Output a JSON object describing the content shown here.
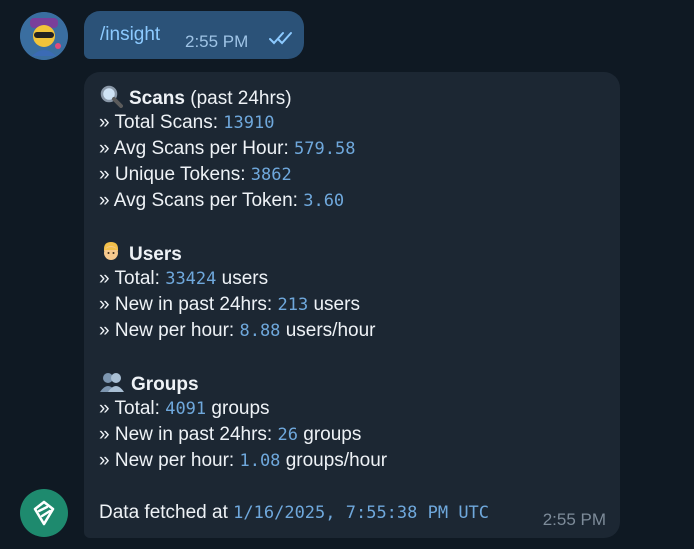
{
  "outgoing": {
    "command": "/insight",
    "time": "2:55 PM",
    "status_icon": "double-check-icon"
  },
  "incoming": {
    "time": "2:55 PM",
    "scans": {
      "icon": "magnifier-icon",
      "title": "Scans",
      "subtitle": "(past 24hrs)",
      "rows": [
        {
          "label": "» Total Scans: ",
          "value": "13910",
          "suffix": ""
        },
        {
          "label": "» Avg Scans per Hour: ",
          "value": "579.58",
          "suffix": ""
        },
        {
          "label": "» Unique Tokens: ",
          "value": "3862",
          "suffix": ""
        },
        {
          "label": "» Avg Scans per Token: ",
          "value": "3.60",
          "suffix": ""
        }
      ]
    },
    "users": {
      "icon": "person-icon",
      "title": "Users",
      "rows": [
        {
          "label": "» Total: ",
          "value": "33424",
          "suffix": " users"
        },
        {
          "label": "» New in past 24hrs: ",
          "value": "213",
          "suffix": " users"
        },
        {
          "label": "» New per hour: ",
          "value": "8.88",
          "suffix": " users/hour"
        }
      ]
    },
    "groups": {
      "icon": "group-icon",
      "title": "Groups",
      "rows": [
        {
          "label": "» Total: ",
          "value": "4091",
          "suffix": " groups"
        },
        {
          "label": "» New in past 24hrs: ",
          "value": "26",
          "suffix": " groups"
        },
        {
          "label": "» New per hour: ",
          "value": "1.08",
          "suffix": " groups/hour"
        }
      ]
    },
    "footer": {
      "label": "Data fetched at ",
      "value": "1/16/2025, 7:55:38 PM UTC"
    }
  }
}
